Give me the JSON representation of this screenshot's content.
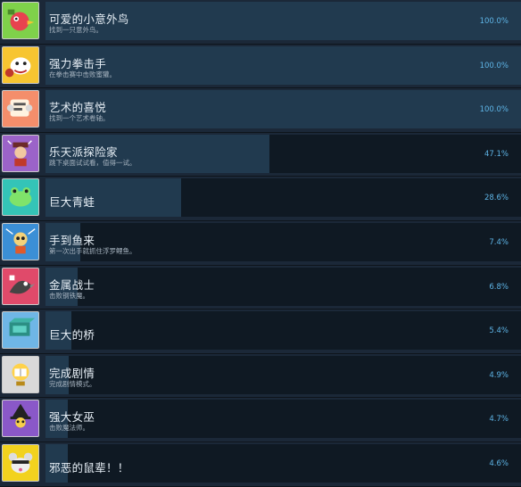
{
  "achievements": [
    {
      "title": "可爱的小意外鸟",
      "desc": "找到一只意外鸟。",
      "percent": "100.0%",
      "fill": 1.0,
      "icon": "bird-icon",
      "bg": "#7fd14a"
    },
    {
      "title": "强力拳击手",
      "desc": "在拳击赛中击败蜜獾。",
      "percent": "100.0%",
      "fill": 1.0,
      "icon": "boxer-dog-icon",
      "bg": "#f7c531"
    },
    {
      "title": "艺术的喜悦",
      "desc": "找到一个艺术卷轴。",
      "percent": "100.0%",
      "fill": 1.0,
      "icon": "scroll-icon",
      "bg": "#f48e6b"
    },
    {
      "title": "乐天派探险家",
      "desc": "跳下桌面试试看，值得一试。",
      "percent": "47.1%",
      "fill": 0.471,
      "icon": "explorer-icon",
      "bg": "#9b63c9"
    },
    {
      "title": "巨大青蛙",
      "desc": "",
      "percent": "28.6%",
      "fill": 0.286,
      "icon": "frog-icon",
      "bg": "#34c4b7"
    },
    {
      "title": "手到鱼来",
      "desc": "第一次出手就抓住浮罗鲤鱼。",
      "percent": "7.4%",
      "fill": 0.074,
      "icon": "fisher-icon",
      "bg": "#3b8fd6"
    },
    {
      "title": "金属战士",
      "desc": "击败钢铁魔。",
      "percent": "6.8%",
      "fill": 0.068,
      "icon": "metal-bird-icon",
      "bg": "#e04a6a"
    },
    {
      "title": "巨大的桥",
      "desc": "",
      "percent": "5.4%",
      "fill": 0.054,
      "icon": "bridge-icon",
      "bg": "#6fb6e6"
    },
    {
      "title": "完成剧情",
      "desc": "完成剧情模式。",
      "percent": "4.9%",
      "fill": 0.049,
      "icon": "trophy-book-icon",
      "bg": "#d9d9d9"
    },
    {
      "title": "强大女巫",
      "desc": "击败魔法师。",
      "percent": "4.7%",
      "fill": 0.047,
      "icon": "witch-icon",
      "bg": "#8a58c8"
    },
    {
      "title": "邪恶的鼠辈！！",
      "desc": "",
      "percent": "4.6%",
      "fill": 0.046,
      "icon": "rat-icon",
      "bg": "#f2d21e"
    }
  ]
}
